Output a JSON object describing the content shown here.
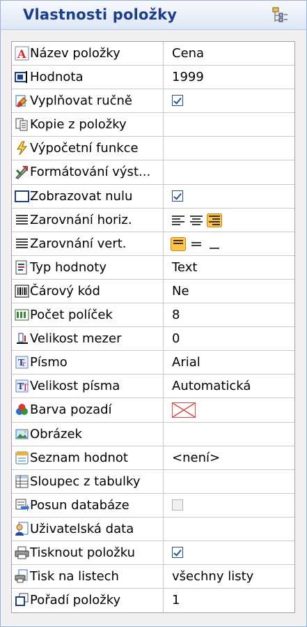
{
  "panel": {
    "title": "Vlastnosti položky"
  },
  "rows": [
    {
      "label": "Název položky",
      "value": "Cena"
    },
    {
      "label": "Hodnota",
      "value": "1999"
    },
    {
      "label": "Vyplňovat ručně",
      "checked": true
    },
    {
      "label": "Kopie z položky",
      "value": ""
    },
    {
      "label": "Výpočetní funkce",
      "value": ""
    },
    {
      "label": "Formátování výst...",
      "value": ""
    },
    {
      "label": "Zobrazovat nulu",
      "checked": true
    },
    {
      "label": "Zarovnání horiz.",
      "selected": "right"
    },
    {
      "label": "Zarovnání vert.",
      "selected": "top"
    },
    {
      "label": "Typ hodnoty",
      "value": "Text"
    },
    {
      "label": "Čárový kód",
      "value": "Ne"
    },
    {
      "label": "Počet políček",
      "value": "8"
    },
    {
      "label": "Velikost mezer",
      "value": "0"
    },
    {
      "label": "Písmo",
      "value": "Arial"
    },
    {
      "label": "Velikost písma",
      "value": "Automatická"
    },
    {
      "label": "Barva pozadí",
      "value": ""
    },
    {
      "label": "Obrázek",
      "value": ""
    },
    {
      "label": "Seznam hodnot",
      "value": "<není>"
    },
    {
      "label": "Sloupec z tabulky",
      "value": ""
    },
    {
      "label": "Posun databáze",
      "checked": false
    },
    {
      "label": "Uživatelská data",
      "value": ""
    },
    {
      "label": "Tisknout položku",
      "checked": true
    },
    {
      "label": "Tisk na listech",
      "value": "všechny listy"
    },
    {
      "label": "Pořadí položky",
      "value": "1"
    }
  ]
}
